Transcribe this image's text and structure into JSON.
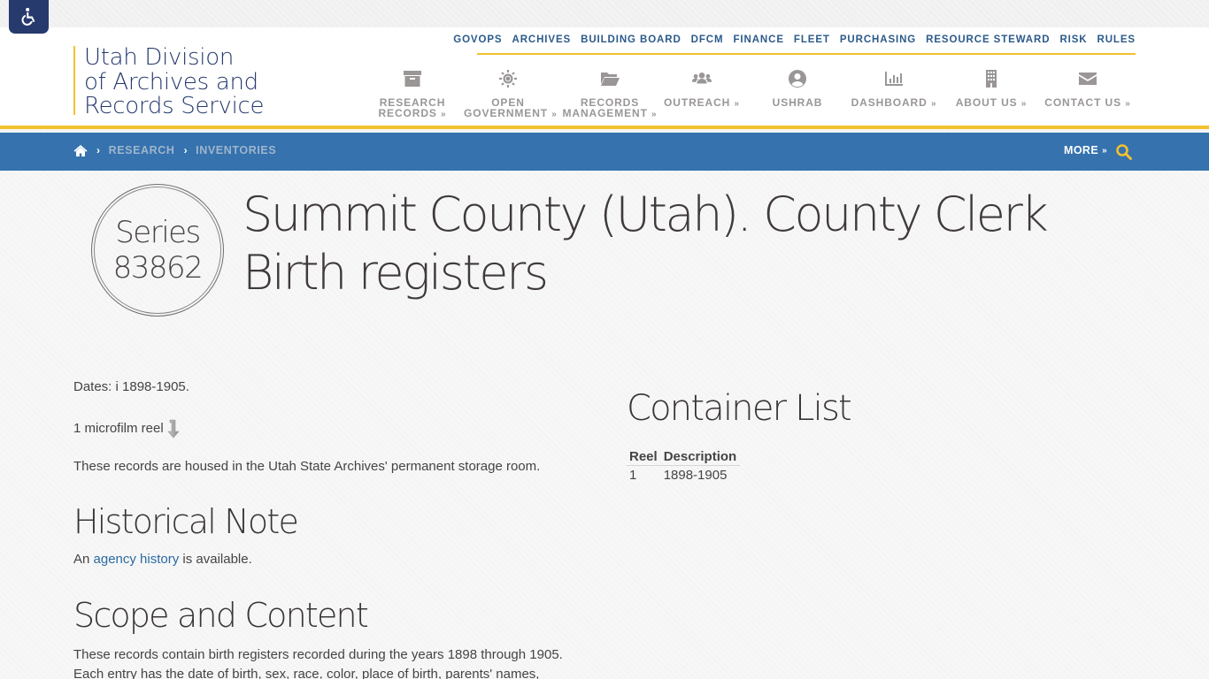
{
  "accessibility": {
    "label": "Accessibility",
    "icon": "wheelchair-icon"
  },
  "logo": {
    "lines": [
      "Utah Division",
      "of Archives and",
      "Records Service"
    ]
  },
  "utility_nav": [
    "GOVOPS",
    "ARCHIVES",
    "BUILDING BOARD",
    "DFCM",
    "FINANCE",
    "FLEET",
    "PURCHASING",
    "RESOURCE STEWARD",
    "RISK",
    "RULES"
  ],
  "main_nav": [
    {
      "line1": "RESEARCH",
      "line2": "RECORDS",
      "icon": "archive-box-icon",
      "dropdown": true
    },
    {
      "line1": "OPEN",
      "line2": "GOVERNMENT",
      "icon": "sun-gear-icon",
      "dropdown": true
    },
    {
      "line1": "RECORDS",
      "line2": "MANAGEMENT",
      "icon": "folder-open-icon",
      "dropdown": true
    },
    {
      "line1": "OUTREACH",
      "line2": "",
      "icon": "users-icon",
      "dropdown": true
    },
    {
      "line1": "USHRAB",
      "line2": "",
      "icon": "user-circle-icon",
      "dropdown": false
    },
    {
      "line1": "DASHBOARD",
      "line2": "",
      "icon": "bar-chart-icon",
      "dropdown": true
    },
    {
      "line1": "ABOUT US",
      "line2": "",
      "icon": "building-icon",
      "dropdown": true
    },
    {
      "line1": "CONTACT US",
      "line2": "",
      "icon": "envelope-icon",
      "dropdown": true
    }
  ],
  "chevron": "»",
  "breadcrumb": {
    "home_icon": "home-icon",
    "items": [
      "RESEARCH",
      "INVENTORIES"
    ],
    "separator": "›"
  },
  "more_label": "MORE",
  "series": {
    "label": "Series",
    "number": "83862"
  },
  "title": "Summit County (Utah). County Clerk Birth registers",
  "details": {
    "dates": "Dates: i 1898-1905.",
    "extent": "1 microfilm reel",
    "housed": "These records are housed in the Utah State Archives' permanent storage room."
  },
  "historical_note": {
    "heading": "Historical Note",
    "prefix": "An ",
    "link": "agency history",
    "suffix": " is available."
  },
  "scope": {
    "heading": "Scope and Content",
    "line1": "These records contain birth registers recorded during the years 1898 through 1905.",
    "line2": "Each entry has the date of birth, sex, race, color, place of birth, parents' names,"
  },
  "container_list": {
    "heading": "Container List",
    "columns": [
      "Reel",
      "Description"
    ],
    "rows": [
      [
        "1",
        "1898-1905"
      ]
    ]
  },
  "colors": {
    "navy": "#263a6e",
    "gold": "#f2c12e",
    "blue_bar": "#3572ae",
    "nav_grey": "#9a9696",
    "link": "#2b6aa0"
  }
}
